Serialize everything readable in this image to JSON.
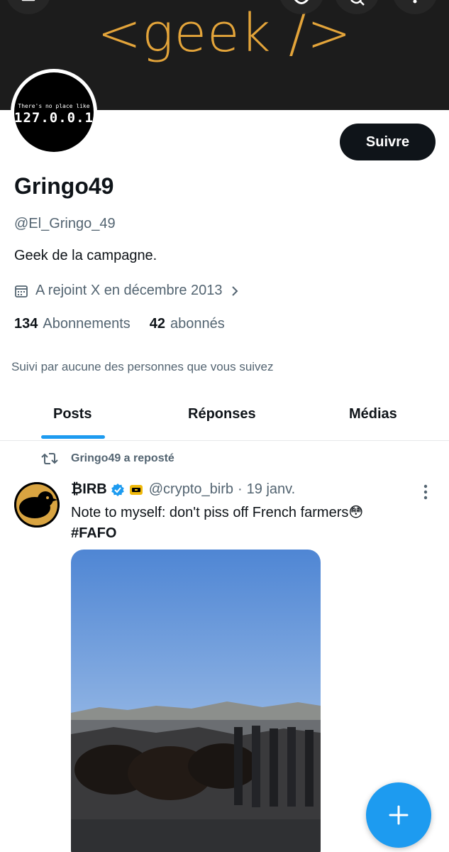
{
  "banner": {
    "text": "<geek />"
  },
  "avatar": {
    "small_text": "There's no place like",
    "big_text": "127.0.0.1"
  },
  "profile": {
    "follow_label": "Suivre",
    "name": "Gringo49",
    "handle": "@El_Gringo_49",
    "bio": "Geek de la campagne.",
    "joined": "A rejoint X en décembre 2013",
    "following_count": "134",
    "following_label": "Abonnements",
    "followers_count": "42",
    "followers_label": "abonnés",
    "followed_by": "Suivi par aucune des personnes que vous suivez"
  },
  "tabs": [
    {
      "label": "Posts",
      "active": true
    },
    {
      "label": "Réponses",
      "active": false
    },
    {
      "label": "Médias",
      "active": false
    }
  ],
  "post": {
    "repost_label": "Gringo49 a reposté",
    "author_name": "₿IRB",
    "author_handle": "@crypto_birb",
    "separator": "·",
    "date": "19 janv.",
    "text": "Note to myself: don't piss off French farmers😳",
    "hashtag": "#FAFO"
  },
  "colors": {
    "accent": "#1d9bf0",
    "banner_text": "#e3a43a",
    "follow_button": "#0f1419",
    "secondary_text": "#536471"
  },
  "icons": [
    "back-icon",
    "search-icon",
    "more-vertical-icon",
    "calendar-icon",
    "chevron-right-icon",
    "repost-icon",
    "verified-badge-icon",
    "plus-icon"
  ]
}
